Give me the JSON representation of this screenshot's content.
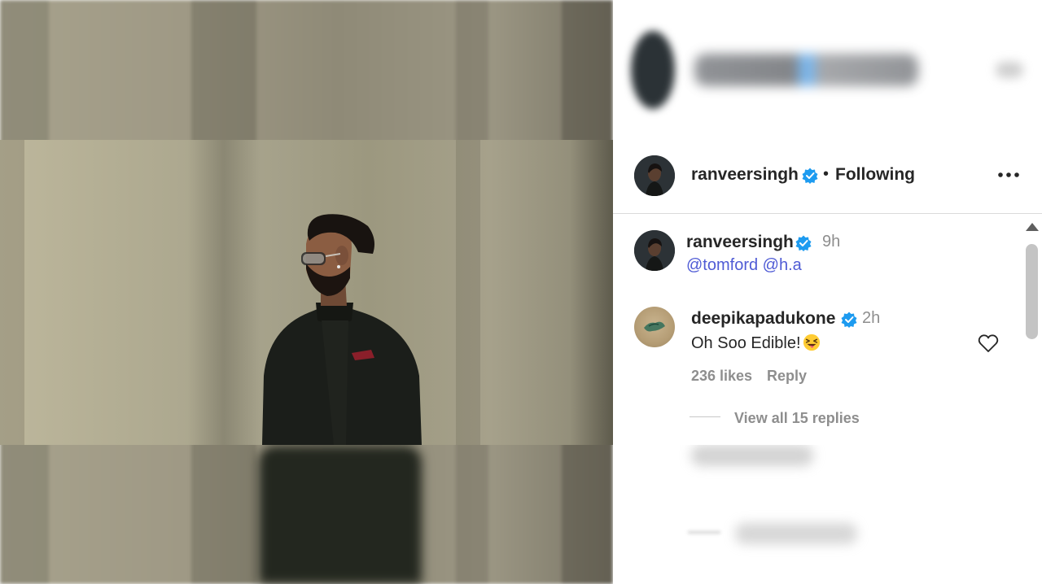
{
  "post": {
    "author": {
      "username": "ranveersingh",
      "verified": true,
      "follow_status": "Following",
      "separator": "•"
    },
    "caption": {
      "username": "ranveersingh",
      "time": "9h",
      "mentions": [
        "@tomford",
        "@h.a"
      ]
    }
  },
  "comments": [
    {
      "username": "deepikapadukone",
      "verified": true,
      "time": "2h",
      "text": "Oh Soo Edible!",
      "emoji": "squinting-face-with-tongue",
      "likes_label": "236 likes",
      "reply_label": "Reply",
      "view_replies_label": "View all 15 replies"
    }
  ],
  "icons": {
    "verified": "verified-badge-icon",
    "more": "more-options-icon",
    "like": "heart-icon",
    "scroll_up": "scroll-up-arrow-icon"
  },
  "colors": {
    "verified_blue": "#1d9bf0",
    "mention_blue": "#4f5bd5",
    "secondary_text": "#8e8e8e",
    "primary_text": "#262626"
  }
}
